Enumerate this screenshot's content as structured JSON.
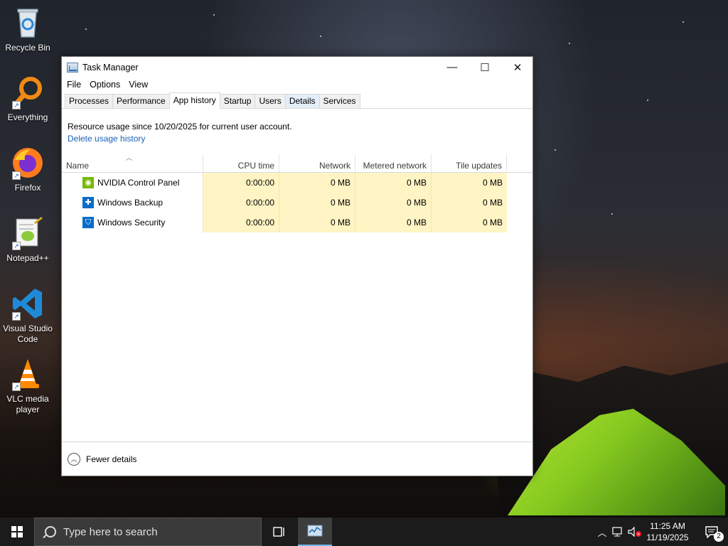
{
  "desktop": {
    "icons": [
      {
        "label": "Recycle Bin"
      },
      {
        "label": "Everything"
      },
      {
        "label": "Firefox"
      },
      {
        "label": "Notepad++"
      },
      {
        "label": "Visual Studio Code"
      },
      {
        "label": "VLC media player"
      }
    ]
  },
  "window": {
    "title": "Task Manager",
    "controls": {
      "minimize": "—",
      "maximize": "☐",
      "close": "✕"
    },
    "menu": [
      "File",
      "Options",
      "View"
    ],
    "tabs": [
      {
        "label": "Processes"
      },
      {
        "label": "Performance"
      },
      {
        "label": "App history"
      },
      {
        "label": "Startup"
      },
      {
        "label": "Users"
      },
      {
        "label": "Details"
      },
      {
        "label": "Services"
      }
    ],
    "active_tab": "App history",
    "info_text": "Resource usage since 10/20/2025 for current user account.",
    "delete_link": "Delete usage history",
    "columns": [
      "Name",
      "CPU time",
      "Network",
      "Metered network",
      "Tile updates"
    ],
    "rows": [
      {
        "name": "NVIDIA Control Panel",
        "cpu": "0:00:00",
        "network": "0 MB",
        "metered": "0 MB",
        "tile": "0 MB",
        "icon": "nvidia-icon",
        "color": "#76b900"
      },
      {
        "name": "Windows Backup",
        "cpu": "0:00:00",
        "network": "0 MB",
        "metered": "0 MB",
        "tile": "0 MB",
        "icon": "backup-icon",
        "color": "#0a6cc8"
      },
      {
        "name": "Windows Security",
        "cpu": "0:00:00",
        "network": "0 MB",
        "metered": "0 MB",
        "tile": "0 MB",
        "icon": "shield-icon",
        "color": "#0a6cc8"
      }
    ],
    "footer_label": "Fewer details"
  },
  "taskbar": {
    "search_placeholder": "Type here to search",
    "time": "11:25 AM",
    "date": "11/19/2025",
    "notification_count": "2"
  },
  "colors": {
    "highlight_cell": "#fff4c4",
    "link": "#1a62b8",
    "taskbar": "#1b1b1b"
  }
}
